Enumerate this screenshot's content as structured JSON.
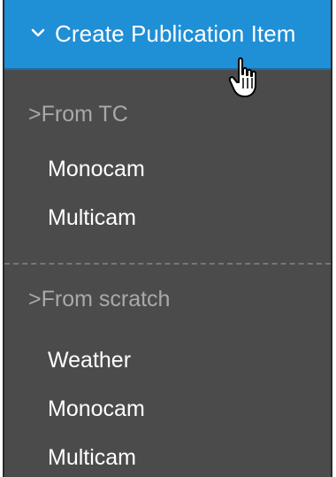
{
  "header": {
    "label": "Create Publication Item",
    "icon": "chevron-down-icon",
    "color": "#1f8fd6"
  },
  "sections": [
    {
      "title": ">From TC",
      "items": [
        "Monocam",
        "Multicam"
      ]
    },
    {
      "title": ">From scratch",
      "items": [
        "Weather",
        "Monocam",
        "Multicam"
      ]
    }
  ],
  "cursor": {
    "icon": "hand-pointer-icon"
  }
}
